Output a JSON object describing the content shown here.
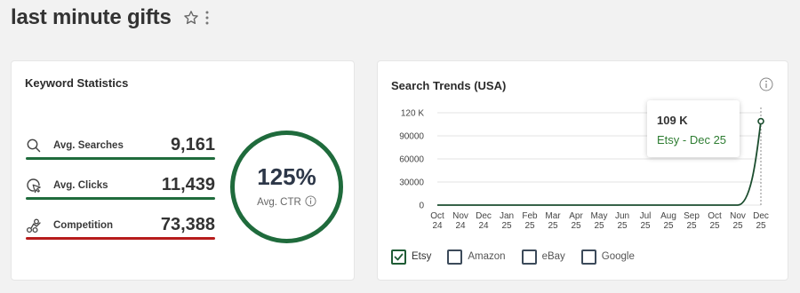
{
  "page": {
    "title": "last minute gifts"
  },
  "keyword_stats": {
    "title": "Keyword Statistics",
    "stats": [
      {
        "label": "Avg. Searches",
        "value": "9,161",
        "icon": "search-icon",
        "bar_color": "#1f6b3c"
      },
      {
        "label": "Avg. Clicks",
        "value": "11,439",
        "icon": "cursor-click-icon",
        "bar_color": "#1f6b3c"
      },
      {
        "label": "Competition",
        "value": "73,388",
        "icon": "competition-icon",
        "bar_color": "#b71c1c"
      }
    ],
    "ctr": {
      "value": "125%",
      "label": "Avg. CTR",
      "ring_color": "#1f6b3c"
    }
  },
  "search_trends": {
    "title": "Search Trends (USA)",
    "tooltip": {
      "value": "109 K",
      "series": "Etsy - Dec 25"
    },
    "legend": [
      {
        "label": "Etsy",
        "checked": true
      },
      {
        "label": "Amazon",
        "checked": false
      },
      {
        "label": "eBay",
        "checked": false
      },
      {
        "label": "Google",
        "checked": false
      }
    ]
  },
  "chart_data": {
    "type": "line",
    "title": "Search Trends (USA)",
    "categories": [
      "Oct 24",
      "Nov 24",
      "Dec 24",
      "Jan 25",
      "Feb 25",
      "Mar 25",
      "Apr 25",
      "May 25",
      "Jun 25",
      "Jul 25",
      "Aug 25",
      "Sep 25",
      "Oct 25",
      "Nov 25",
      "Dec 25"
    ],
    "x_tick_labels": [
      [
        "Oct",
        "24"
      ],
      [
        "Nov",
        "24"
      ],
      [
        "Dec",
        "24"
      ],
      [
        "Jan",
        "25"
      ],
      [
        "Feb",
        "25"
      ],
      [
        "Mar",
        "25"
      ],
      [
        "Apr",
        "25"
      ],
      [
        "May",
        "25"
      ],
      [
        "Jun",
        "25"
      ],
      [
        "Jul",
        "25"
      ],
      [
        "Aug",
        "25"
      ],
      [
        "Sep",
        "25"
      ],
      [
        "Oct",
        "25"
      ],
      [
        "Nov",
        "25"
      ],
      [
        "Dec",
        "25"
      ]
    ],
    "y_ticks": [
      0,
      30000,
      60000,
      90000,
      120000
    ],
    "y_tick_labels": [
      "0",
      "30000",
      "60000",
      "90000",
      "120 K"
    ],
    "ylim": [
      0,
      120000
    ],
    "grid": true,
    "legend_position": "bottom-left",
    "series": [
      {
        "name": "Etsy",
        "color": "#1b4d2e",
        "values": [
          0,
          0,
          0,
          0,
          0,
          0,
          0,
          0,
          0,
          0,
          0,
          0,
          0,
          0,
          109000
        ]
      }
    ]
  }
}
